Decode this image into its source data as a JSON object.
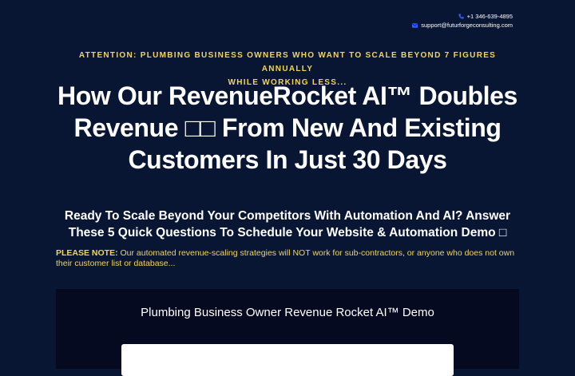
{
  "contact": {
    "phone": "+1 346-639-4895",
    "email": "support@futurforgeconsulting.com",
    "phone_icon": "phone-icon",
    "email_icon": "envelope-icon"
  },
  "hero": {
    "attention_line1": "ATTENTION: PLUMBING BUSINESS OWNERS WHO WANT TO SCALE BEYOND 7 FIGURES ANNUALLY",
    "attention_line2": "WHILE WORKING LESS...",
    "headline_line1": "How Our RevenueRocket AI™ Doubles",
    "headline_line2": "Revenue □□ From New And Existing",
    "headline_line3": "Customers In Just 30 Days",
    "subhead_line1": "Ready To Scale Beyond Your Competitors With Automation And AI? Answer",
    "subhead_line2": "These 5 Quick Questions To Schedule Your Website & Automation Demo □"
  },
  "note": {
    "label": "PLEASE NOTE:",
    "text": " Our automated revenue-scaling strategies will NOT work for sub-contractors, or anyone who does not own their customer list or database..."
  },
  "form": {
    "title": "Plumbing Business Owner Revenue Rocket AI™ Demo"
  },
  "colors": {
    "background": "#081634",
    "panel": "#050a21",
    "accent_yellow": "#f2d45b",
    "icon_blue": "#2f5bff"
  }
}
